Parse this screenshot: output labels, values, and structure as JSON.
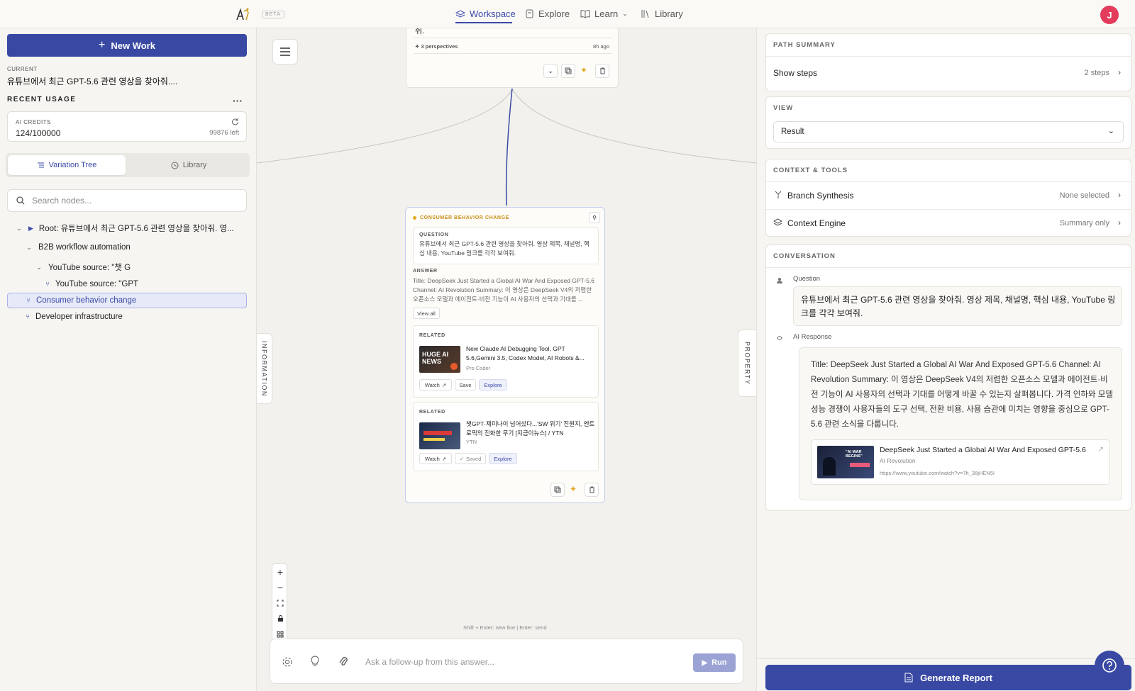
{
  "topbar": {
    "beta": "BETA",
    "nav": {
      "workspace": "Workspace",
      "explore": "Explore",
      "learn": "Learn",
      "library": "Library"
    },
    "avatar_initial": "J"
  },
  "sidebar": {
    "new_work": "New Work",
    "current_label": "CURRENT",
    "current_title": "유튜브에서 최근 GPT-5.6 관련 영상을 찾아줘....",
    "recent_usage": "RECENT USAGE",
    "credits_label": "AI CREDITS",
    "credits_value": "124/100000",
    "credits_left": "99876 left",
    "tab_tree": "Variation Tree",
    "tab_library": "Library",
    "search_placeholder": "Search nodes...",
    "tree": [
      {
        "label": "Root: 유튜브에서 최근 GPT-5.6 관련 영상을 찾아줘. 영..."
      },
      {
        "label": "B2B workflow automation"
      },
      {
        "label": "YouTube source: \"챗 G"
      },
      {
        "label": "YouTube source: \"GPT"
      },
      {
        "label": "Consumer behavior change"
      },
      {
        "label": "Developer infrastructure"
      }
    ]
  },
  "canvas": {
    "top_card": {
      "tail_text": "쉬.",
      "perspectives": "✦ 3 perspectives",
      "time": "8h ago"
    },
    "node": {
      "title": "CONSUMER BEHAVIOR CHANGE",
      "question_label": "QUESTION",
      "question": "유튜브에서 최근 GPT-5.6 관련 영상을 찾아줘. 영상 제목, 채널명, 핵심 내용, YouTube 링크를 각각 보여줘.",
      "answer_label": "ANSWER",
      "answer": "Title: DeepSeek Just Started a Global AI War And Exposed GPT-5.6 Channel: AI Revolution Summary: 이 영상은 DeepSeek V4의 저렴한 오픈소스 모델과 에이전트·비전 기능이 AI 사용자의 선택과 기대를 ...",
      "view_all": "View all",
      "related": [
        {
          "label": "RELATED",
          "title": "New Claude AI Debugging Tool, GPT 5.6,Gemini 3.5, Codex Model, AI Robots &...",
          "channel": "Pro Coder",
          "watch": "Watch",
          "save": "Save",
          "explore": "Explore",
          "thumb_text": "HUGE AI NEWS"
        },
        {
          "label": "RELATED",
          "title": "챗GPT·제미나이 넘어섰다...'SW 위기' 진원지, 엔트로픽의 진화한 무기 [지금이뉴스] / YTN",
          "channel": "YTN",
          "watch": "Watch",
          "save": "Saved",
          "explore": "Explore"
        }
      ]
    },
    "info_label": "INFORMATION",
    "property_label": "PROPERTY",
    "hint": "Shift + Enter: new line | Enter: send",
    "composer_placeholder": "Ask a follow-up from this answer...",
    "run": "Run"
  },
  "right": {
    "path_summary": "PATH SUMMARY",
    "show_steps": "Show steps",
    "steps": "2 steps",
    "view": "VIEW",
    "view_selected": "Result",
    "context_tools": "CONTEXT & TOOLS",
    "branch_synthesis": "Branch Synthesis",
    "branch_value": "None selected",
    "context_engine": "Context Engine",
    "context_value": "Summary only",
    "conversation": "CONVERSATION",
    "question_label": "Question",
    "question": "유튜브에서 최근 GPT-5.6 관련 영상을 찾아줘. 영상 제목, 채널명, 핵심 내용, YouTube 링크를 각각 보여줘.",
    "ai_label": "AI Response",
    "ai_response": "Title: DeepSeek Just Started a Global AI War And Exposed GPT-5.6 Channel: AI Revolution Summary: 이 영상은 DeepSeek V4의 저렴한 오픈소스 모델과 에이전트·비전 기능이 AI 사용자의 선택과 기대를 어떻게 바꿀 수 있는지 살펴봅니다. 가격 인하와 모델 성능 경쟁이 사용자들의 도구 선택, 전환 비용, 사용 습관에 미치는 영향을 중심으로 GPT-5.6 관련 소식을 다룹니다.",
    "link_title": "DeepSeek Just Started a Global AI War And Exposed GPT-5.6",
    "link_channel": "AI Revolution",
    "link_url": "https://www.youtube.com/watch?v=7h_38jHEN5I",
    "thumb_text": "\"AI WAR BEGINS\"",
    "generate_report": "Generate Report"
  },
  "colors": {
    "accent": "#3949a3",
    "selected_bg": "#e6e9f7",
    "avatar": "#e23b5b",
    "sparkle": "#e2a81f"
  }
}
